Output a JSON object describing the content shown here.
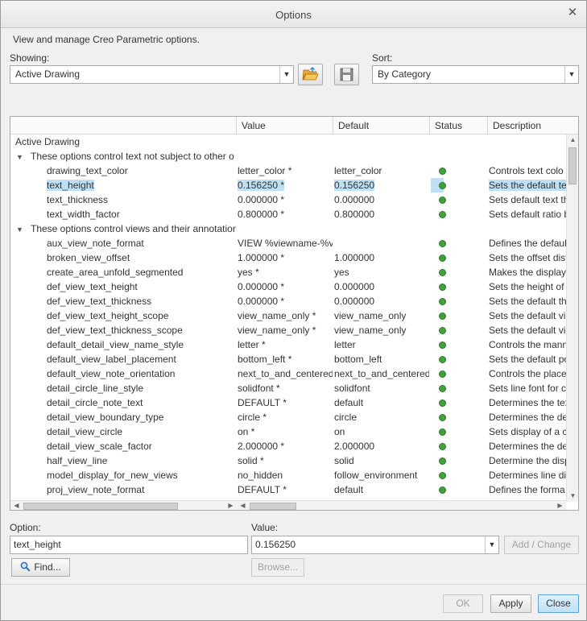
{
  "window": {
    "title": "Options",
    "close_glyph": "✕"
  },
  "intro": "View and manage Creo Parametric options.",
  "showing": {
    "label": "Showing:",
    "value": "Active Drawing"
  },
  "sort": {
    "label": "Sort:",
    "value": "By Category"
  },
  "icons": {
    "open": "folder-open-icon",
    "save": "save-icon",
    "status": "green-status-dot"
  },
  "columns": [
    "",
    "Value",
    "Default",
    "Status",
    "Description"
  ],
  "table": {
    "root": "Active Drawing",
    "groups": [
      {
        "label": "These options control text not subject to other o",
        "rows": [
          {
            "name": "drawing_text_color",
            "value": "letter_color *",
            "default": "letter_color",
            "desc": "Controls text colo"
          },
          {
            "name": "text_height",
            "value": "0.156250 *",
            "default": "0.156250",
            "desc": "Sets the default te",
            "selected": true
          },
          {
            "name": "text_thickness",
            "value": "0.000000 *",
            "default": "0.000000",
            "desc": "Sets default text th"
          },
          {
            "name": "text_width_factor",
            "value": "0.800000 *",
            "default": "0.800000",
            "desc": "Sets default ratio b"
          }
        ]
      },
      {
        "label": "These options control views and their annotation",
        "rows": [
          {
            "name": "aux_view_note_format",
            "value": "VIEW %viewname-%vi",
            "default": "",
            "desc": "Defines the defaul"
          },
          {
            "name": "broken_view_offset",
            "value": "1.000000 *",
            "default": "1.000000",
            "desc": "Sets the offset dist"
          },
          {
            "name": "create_area_unfold_segmented",
            "value": "yes *",
            "default": "yes",
            "desc": "Makes the display"
          },
          {
            "name": "def_view_text_height",
            "value": "0.000000 *",
            "default": "0.000000",
            "desc": "Sets the height of"
          },
          {
            "name": "def_view_text_thickness",
            "value": "0.000000 *",
            "default": "0.000000",
            "desc": "Sets the default thickn"
          },
          {
            "name": "def_view_text_height_scope",
            "value": "view_name_only *",
            "default": "view_name_only",
            "desc": "Sets the default vi"
          },
          {
            "name": "def_view_text_thickness_scope",
            "value": "view_name_only *",
            "default": "view_name_only",
            "desc": "Sets the default vi"
          },
          {
            "name": "default_detail_view_name_style",
            "value": "letter *",
            "default": "letter",
            "desc": "Controls the mann"
          },
          {
            "name": "default_view_label_placement",
            "value": "bottom_left *",
            "default": "bottom_left",
            "desc": "Sets the default po"
          },
          {
            "name": "default_view_note_orientation",
            "value": "next_to_and_centered",
            "default": "next_to_and_centered",
            "desc": "Controls the place"
          },
          {
            "name": "detail_circle_line_style",
            "value": "solidfont *",
            "default": "solidfont",
            "desc": "Sets line font for c"
          },
          {
            "name": "detail_circle_note_text",
            "value": "DEFAULT *",
            "default": "default",
            "desc": "Determines the tex"
          },
          {
            "name": "detail_view_boundary_type",
            "value": "circle *",
            "default": "circle",
            "desc": "Determines the de"
          },
          {
            "name": "detail_view_circle",
            "value": "on *",
            "default": "on",
            "desc": "Sets display of a ci"
          },
          {
            "name": "detail_view_scale_factor",
            "value": "2.000000 *",
            "default": "2.000000",
            "desc": "Determines the de"
          },
          {
            "name": "half_view_line",
            "value": "solid *",
            "default": "solid",
            "desc": "Determine the disp"
          },
          {
            "name": "model_display_for_new_views",
            "value": "no_hidden",
            "default": "follow_environment",
            "desc": "Determines line di"
          },
          {
            "name": "proj_view_note_format",
            "value": "DEFAULT *",
            "default": "default",
            "desc": "Defines the forma"
          }
        ]
      }
    ]
  },
  "option": {
    "label": "Option:",
    "value": "text_height"
  },
  "value": {
    "label": "Value:",
    "value": "0.156250"
  },
  "buttons": {
    "add_change": "Add / Change",
    "find": "Find...",
    "browse": "Browse...",
    "ok": "OK",
    "apply": "Apply",
    "close": "Close"
  }
}
